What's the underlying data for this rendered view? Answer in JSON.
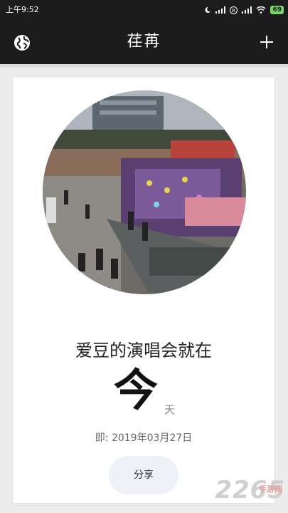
{
  "status": {
    "time": "上午9:52",
    "battery": "69"
  },
  "appbar": {
    "title": "荏苒"
  },
  "card": {
    "headline": "爱豆的演唱会就在",
    "big_word": "今",
    "unit": "天",
    "date": "即: 2019年03月27日",
    "share_label": "分享"
  },
  "watermark": {
    "text": "2265",
    "sub": "手游网"
  },
  "colors": {
    "bar": "#1c1c1c",
    "card": "#ffffff",
    "share_bg": "#eef1f8",
    "battery": "#7bd46b"
  }
}
